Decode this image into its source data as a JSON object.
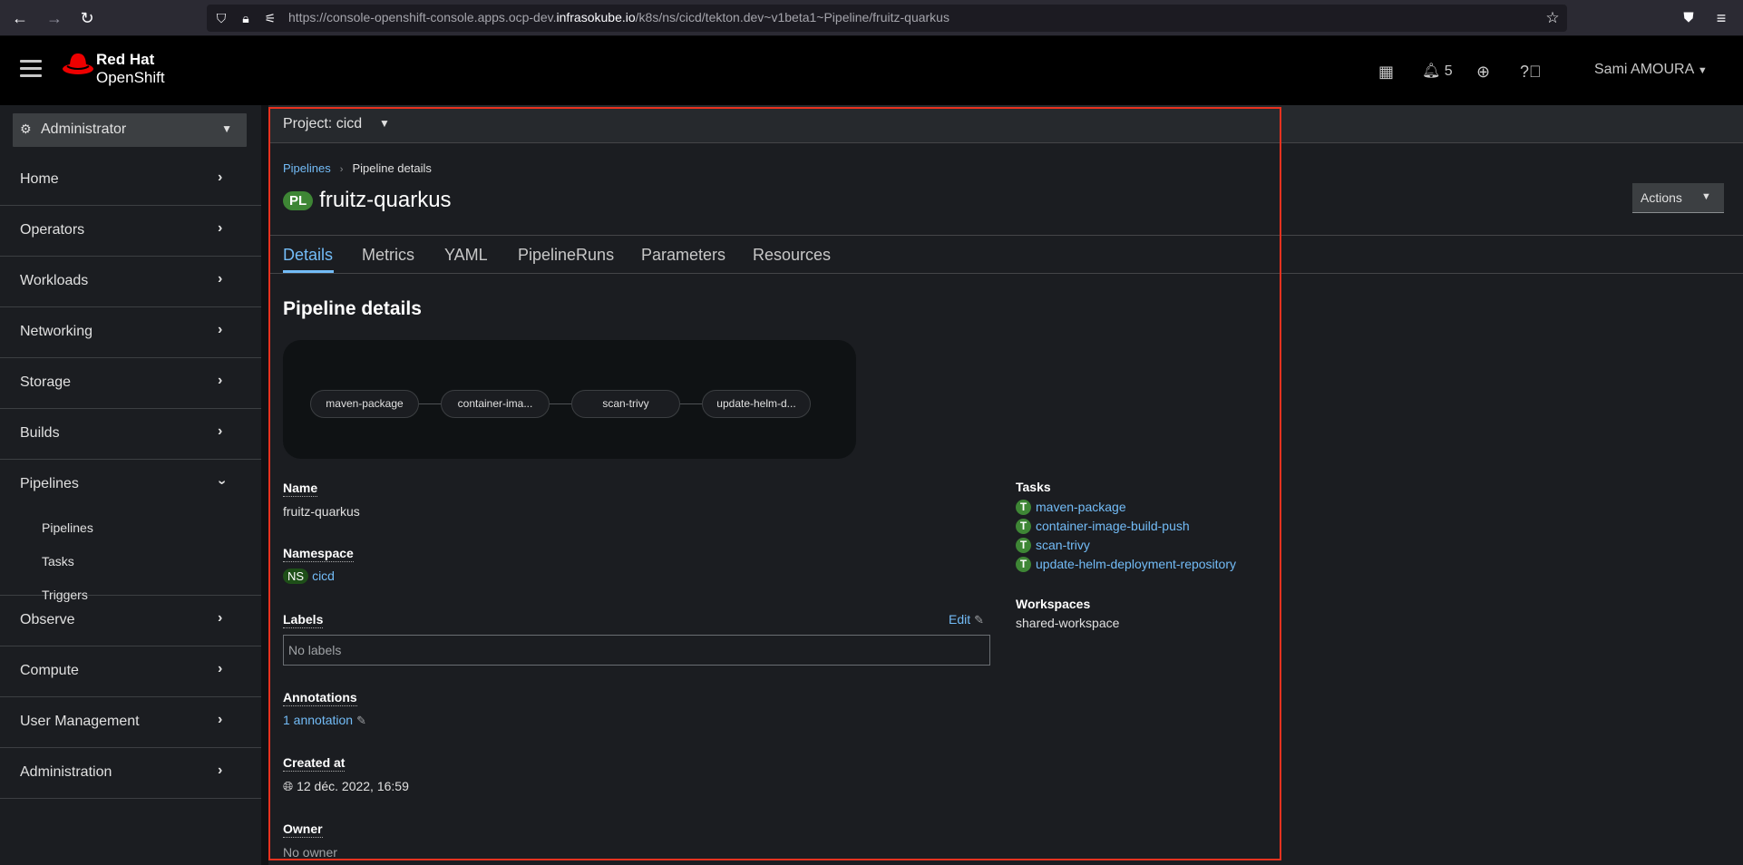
{
  "browser": {
    "url_prefix": "https://console-openshift-console.apps.ocp-dev.",
    "url_domain": "infrasokube.io",
    "url_path": "/k8s/ns/cicd/tekton.dev~v1beta1~Pipeline/fruitz-quarkus"
  },
  "masthead": {
    "brand_line1": "Red Hat",
    "brand_line2": "OpenShift",
    "notifications_count": "5",
    "user_name": "Sami AMOURA"
  },
  "sidebar": {
    "perspective": "Administrator",
    "items": [
      {
        "label": "Home",
        "expanded": false
      },
      {
        "label": "Operators",
        "expanded": false
      },
      {
        "label": "Workloads",
        "expanded": false
      },
      {
        "label": "Networking",
        "expanded": false
      },
      {
        "label": "Storage",
        "expanded": false
      },
      {
        "label": "Builds",
        "expanded": false
      },
      {
        "label": "Pipelines",
        "expanded": true,
        "children": [
          "Pipelines",
          "Tasks",
          "Triggers"
        ]
      },
      {
        "label": "Observe",
        "expanded": false
      },
      {
        "label": "Compute",
        "expanded": false
      },
      {
        "label": "User Management",
        "expanded": false
      },
      {
        "label": "Administration",
        "expanded": false
      }
    ]
  },
  "project_bar": {
    "label": "Project: cicd"
  },
  "breadcrumb": {
    "parent": "Pipelines",
    "separator": "›",
    "current": "Pipeline details"
  },
  "header": {
    "badge": "PL",
    "title": "fruitz-quarkus",
    "actions_label": "Actions"
  },
  "tabs": [
    {
      "label": "Details",
      "active": true
    },
    {
      "label": "Metrics",
      "active": false
    },
    {
      "label": "YAML",
      "active": false
    },
    {
      "label": "PipelineRuns",
      "active": false
    },
    {
      "label": "Parameters",
      "active": false
    },
    {
      "label": "Resources",
      "active": false
    }
  ],
  "details": {
    "section_title": "Pipeline details",
    "graph_nodes": [
      "maven-package",
      "container-ima...",
      "scan-trivy",
      "update-helm-d..."
    ],
    "name_label": "Name",
    "name_value": "fruitz-quarkus",
    "namespace_label": "Namespace",
    "namespace_badge": "NS",
    "namespace_value": "cicd",
    "labels_label": "Labels",
    "labels_edit": "Edit",
    "labels_empty": "No labels",
    "annotations_label": "Annotations",
    "annotations_value": "1 annotation",
    "created_label": "Created at",
    "created_value": "12 déc. 2022, 16:59",
    "owner_label": "Owner",
    "owner_value": "No owner",
    "tasks_label": "Tasks",
    "task_badge": "T",
    "tasks": [
      "maven-package",
      "container-image-build-push",
      "scan-trivy",
      "update-helm-deployment-repository"
    ],
    "workspaces_label": "Workspaces",
    "workspaces_value": "shared-workspace"
  },
  "colors": {
    "accent_link": "#73bcf7",
    "badge_green": "#3e8635",
    "highlight_red": "#e8321f",
    "redhat_red": "#ee0000"
  }
}
